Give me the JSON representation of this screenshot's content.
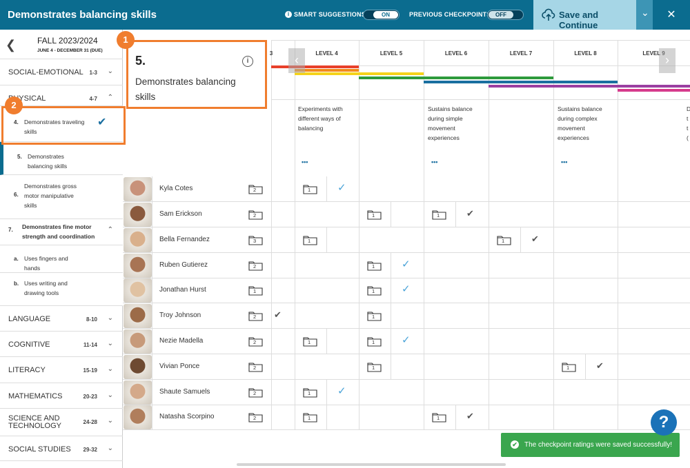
{
  "header": {
    "title": "Demonstrates balancing skills",
    "smart_label": "SMART SUGGESTIONS",
    "smart_state": "ON",
    "prev_label": "PREVIOUS CHECKPOINTS",
    "prev_state": "OFF",
    "save_label": "Save and Continue",
    "close": "✕",
    "caret": "⌄"
  },
  "sidebar": {
    "season": "FALL 2023/2024",
    "dates": "JUNE 4 - DECEMBER 31 (DUE)",
    "domains_top": [
      {
        "name": "SOCIAL-EMOTIONAL",
        "range": "1-3",
        "chev": "⌄"
      },
      {
        "name": "PHYSICAL",
        "range": "4-7",
        "chev": "⌃"
      }
    ],
    "subs": [
      {
        "num": "4.",
        "text": "Demonstrates traveling skills",
        "check": "✔"
      },
      {
        "num": "5.",
        "text": "Demonstrates balancing skills"
      },
      {
        "num": "6.",
        "text": "Demonstrates gross motor manipulative skills"
      },
      {
        "num": "7.",
        "text": "Demonstrates fine motor strength and coordination",
        "chev": "⌃"
      },
      {
        "num": "a.",
        "text": "Uses fingers and hands"
      },
      {
        "num": "b.",
        "text": "Uses writing and drawing tools"
      }
    ],
    "domains_bottom": [
      {
        "name": "LANGUAGE",
        "range": "8-10"
      },
      {
        "name": "COGNITIVE",
        "range": "11-14"
      },
      {
        "name": "LITERACY",
        "range": "15-19"
      },
      {
        "name": "MATHEMATICS",
        "range": "20-23"
      },
      {
        "name": "SCIENCE AND TECHNOLOGY",
        "range": "24-28"
      },
      {
        "name": "SOCIAL STUDIES",
        "range": "29-32"
      }
    ]
  },
  "detail": {
    "number": "5.",
    "title": "Demonstrates balancing skills",
    "info": "i"
  },
  "badges": [
    "1",
    "2"
  ],
  "levels": [
    "3",
    "LEVEL 4",
    "LEVEL 5",
    "LEVEL 6",
    "LEVEL 7",
    "LEVEL 8",
    "LEVEL 9"
  ],
  "level_descriptions": [
    {
      "text": "Experiments with different ways of balancing",
      "dots": "•••"
    },
    {
      "text": "Sustains balance during simple movement experiences",
      "dots": "•••"
    },
    {
      "text": "Sustains balance during complex movement experiences",
      "dots": "•••"
    },
    {
      "text": "D t t (",
      "dots": ""
    }
  ],
  "students": [
    {
      "name": "Kyla Cotes",
      "count": "2",
      "marks": [
        {
          "col": 1,
          "n": "1",
          "check": "suggested"
        }
      ]
    },
    {
      "name": "Sam Erickson",
      "count": "2",
      "marks": [
        {
          "col": 2,
          "n": "1"
        },
        {
          "col": 3,
          "n": "1",
          "check": "confirmed"
        }
      ]
    },
    {
      "name": "Bella Fernandez",
      "count": "3",
      "marks": [
        {
          "col": 1,
          "n": "1"
        },
        {
          "col": 4,
          "n": "1",
          "check": "confirmed"
        }
      ]
    },
    {
      "name": "Ruben Gutierez",
      "count": "2",
      "marks": [
        {
          "col": 2,
          "n": "1",
          "check": "suggested"
        }
      ]
    },
    {
      "name": "Jonathan Hurst",
      "count": "1",
      "marks": [
        {
          "col": 2,
          "n": "1",
          "check": "suggested"
        }
      ]
    },
    {
      "name": "Troy Johnson",
      "count": "2",
      "marks": [
        {
          "col": 0,
          "check": "confirmed"
        },
        {
          "col": 2,
          "n": "1"
        }
      ]
    },
    {
      "name": "Nezie Madella",
      "count": "2",
      "marks": [
        {
          "col": 1,
          "n": "1"
        },
        {
          "col": 2,
          "n": "1",
          "check": "suggested"
        }
      ]
    },
    {
      "name": "Vivian Ponce",
      "count": "2",
      "marks": [
        {
          "col": 2,
          "n": "1"
        },
        {
          "col": 5,
          "n": "1",
          "check": "confirmed"
        }
      ]
    },
    {
      "name": "Shaute Samuels",
      "count": "2",
      "marks": [
        {
          "col": 1,
          "n": "1",
          "check": "suggested"
        }
      ]
    },
    {
      "name": "Natasha Scorpino",
      "count": "2",
      "marks": [
        {
          "col": 1,
          "n": "1"
        },
        {
          "col": 3,
          "n": "1",
          "check": "confirmed"
        }
      ]
    }
  ],
  "nav": {
    "prev": "‹",
    "next": "›"
  },
  "toast": {
    "icon": "✔",
    "message": "The checkpoint ratings were saved successfully!"
  },
  "help": "?",
  "colors": {
    "brand": "#0b6c8f",
    "accent": "#f07d2e",
    "success": "#3aa64e",
    "check_suggested": "#4aa3d8",
    "check_confirmed": "#555555"
  },
  "icons": {
    "folder": "folder-icon",
    "check": "check-icon",
    "info": "info-icon",
    "upload": "cloud-upload-icon"
  }
}
